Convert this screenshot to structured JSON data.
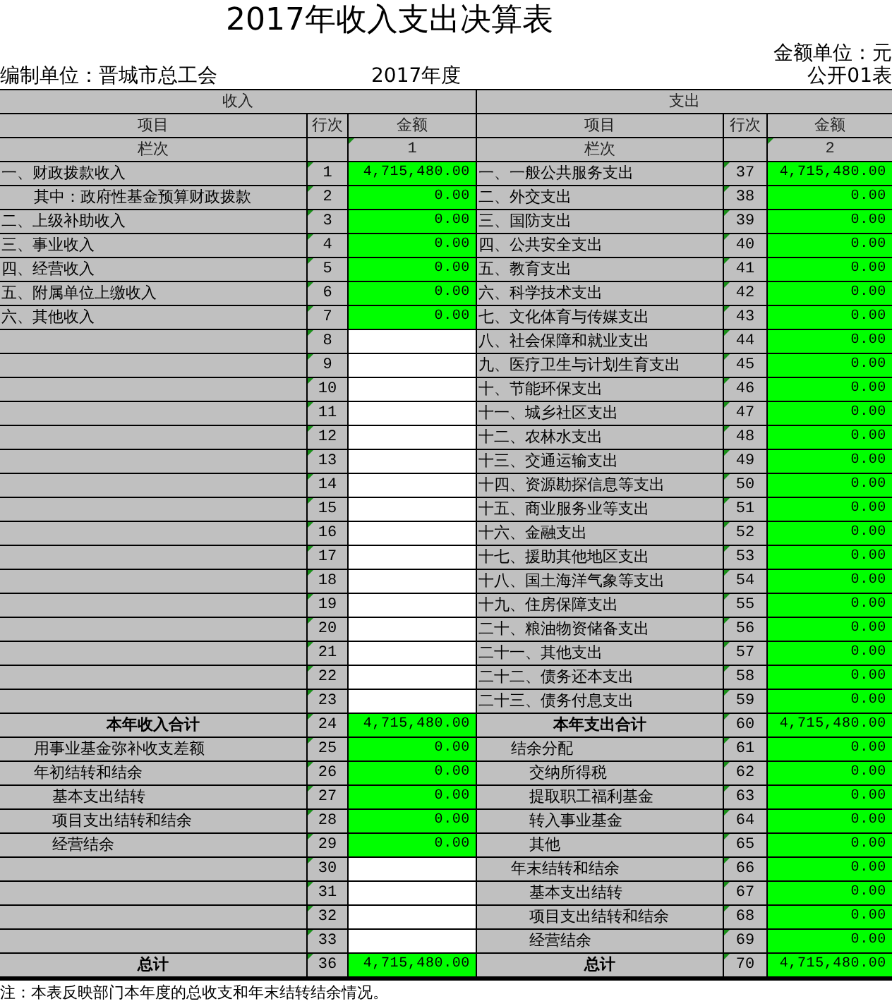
{
  "title": "2017年收入支出决算表",
  "unit_label": "金额单位：元",
  "org_label": "编制单位：晋城市总工会",
  "year_label": "2017年度",
  "form_label": "公开01表",
  "sections": [
    "收入",
    "支出"
  ],
  "columns": [
    "项目",
    "行次",
    "金额",
    "项目",
    "行次",
    "金额"
  ],
  "index_row": {
    "left_label": "栏次",
    "left_number": "1",
    "right_label": "栏次",
    "right_number": "2"
  },
  "rows": [
    {
      "left": {
        "kind": "item",
        "item": "一、财政拨款收入",
        "line": "1",
        "amount": "4,715,480.00",
        "highlighted": true
      },
      "right": {
        "kind": "item",
        "item": "一、一般公共服务支出",
        "line": "37",
        "amount": "4,715,480.00",
        "highlighted": true
      }
    },
    {
      "left": {
        "kind": "sub",
        "item": "其中：政府性基金预算财政拨款",
        "line": "2",
        "amount": "0.00",
        "highlighted": true
      },
      "right": {
        "kind": "item",
        "item": "二、外交支出",
        "line": "38",
        "amount": "0.00",
        "highlighted": true
      }
    },
    {
      "left": {
        "kind": "item",
        "item": "二、上级补助收入",
        "line": "3",
        "amount": "0.00",
        "highlighted": true
      },
      "right": {
        "kind": "item",
        "item": "三、国防支出",
        "line": "39",
        "amount": "0.00",
        "highlighted": true
      }
    },
    {
      "left": {
        "kind": "item",
        "item": "三、事业收入",
        "line": "4",
        "amount": "0.00",
        "highlighted": true
      },
      "right": {
        "kind": "item",
        "item": "四、公共安全支出",
        "line": "40",
        "amount": "0.00",
        "highlighted": true
      }
    },
    {
      "left": {
        "kind": "item",
        "item": "四、经营收入",
        "line": "5",
        "amount": "0.00",
        "highlighted": true
      },
      "right": {
        "kind": "item",
        "item": "五、教育支出",
        "line": "41",
        "amount": "0.00",
        "highlighted": true
      }
    },
    {
      "left": {
        "kind": "item",
        "item": "五、附属单位上缴收入",
        "line": "6",
        "amount": "0.00",
        "highlighted": true
      },
      "right": {
        "kind": "item",
        "item": "六、科学技术支出",
        "line": "42",
        "amount": "0.00",
        "highlighted": true
      }
    },
    {
      "left": {
        "kind": "item",
        "item": "六、其他收入",
        "line": "7",
        "amount": "0.00",
        "highlighted": true
      },
      "right": {
        "kind": "item",
        "item": "七、文化体育与传媒支出",
        "line": "43",
        "amount": "0.00",
        "highlighted": true
      }
    },
    {
      "left": {
        "kind": "blank",
        "line": "8",
        "highlighted": false
      },
      "right": {
        "kind": "item",
        "item": "八、社会保障和就业支出",
        "line": "44",
        "amount": "0.00",
        "highlighted": true
      }
    },
    {
      "left": {
        "kind": "blank",
        "line": "9",
        "highlighted": false
      },
      "right": {
        "kind": "item",
        "item": "九、医疗卫生与计划生育支出",
        "line": "45",
        "amount": "0.00",
        "highlighted": true
      }
    },
    {
      "left": {
        "kind": "blank",
        "line": "10",
        "highlighted": false
      },
      "right": {
        "kind": "item",
        "item": "十、节能环保支出",
        "line": "46",
        "amount": "0.00",
        "highlighted": true
      }
    },
    {
      "left": {
        "kind": "blank",
        "line": "11",
        "highlighted": false
      },
      "right": {
        "kind": "item",
        "item": "十一、城乡社区支出",
        "line": "47",
        "amount": "0.00",
        "highlighted": true
      }
    },
    {
      "left": {
        "kind": "blank",
        "line": "12",
        "highlighted": false
      },
      "right": {
        "kind": "item",
        "item": "十二、农林水支出",
        "line": "48",
        "amount": "0.00",
        "highlighted": true
      }
    },
    {
      "left": {
        "kind": "blank",
        "line": "13",
        "highlighted": false
      },
      "right": {
        "kind": "item",
        "item": "十三、交通运输支出",
        "line": "49",
        "amount": "0.00",
        "highlighted": true
      }
    },
    {
      "left": {
        "kind": "blank",
        "line": "14",
        "highlighted": false
      },
      "right": {
        "kind": "item",
        "item": "十四、资源勘探信息等支出",
        "line": "50",
        "amount": "0.00",
        "highlighted": true
      }
    },
    {
      "left": {
        "kind": "blank",
        "line": "15",
        "highlighted": false
      },
      "right": {
        "kind": "item",
        "item": "十五、商业服务业等支出",
        "line": "51",
        "amount": "0.00",
        "highlighted": true
      }
    },
    {
      "left": {
        "kind": "blank",
        "line": "16",
        "highlighted": false
      },
      "right": {
        "kind": "item",
        "item": "十六、金融支出",
        "line": "52",
        "amount": "0.00",
        "highlighted": true
      }
    },
    {
      "left": {
        "kind": "blank",
        "line": "17",
        "highlighted": false
      },
      "right": {
        "kind": "item",
        "item": "十七、援助其他地区支出",
        "line": "53",
        "amount": "0.00",
        "highlighted": true
      }
    },
    {
      "left": {
        "kind": "blank",
        "line": "18",
        "highlighted": false
      },
      "right": {
        "kind": "item",
        "item": "十八、国土海洋气象等支出",
        "line": "54",
        "amount": "0.00",
        "highlighted": true
      }
    },
    {
      "left": {
        "kind": "blank",
        "line": "19",
        "highlighted": false
      },
      "right": {
        "kind": "item",
        "item": "十九、住房保障支出",
        "line": "55",
        "amount": "0.00",
        "highlighted": true
      }
    },
    {
      "left": {
        "kind": "blank",
        "line": "20",
        "highlighted": false
      },
      "right": {
        "kind": "item",
        "item": "二十、粮油物资储备支出",
        "line": "56",
        "amount": "0.00",
        "highlighted": true
      }
    },
    {
      "left": {
        "kind": "blank",
        "line": "21",
        "highlighted": false
      },
      "right": {
        "kind": "item",
        "item": "二十一、其他支出",
        "line": "57",
        "amount": "0.00",
        "highlighted": true
      }
    },
    {
      "left": {
        "kind": "blank",
        "line": "22",
        "highlighted": false
      },
      "right": {
        "kind": "item",
        "item": "二十二、债务还本支出",
        "line": "58",
        "amount": "0.00",
        "highlighted": true
      }
    },
    {
      "left": {
        "kind": "blank",
        "line": "23",
        "highlighted": false
      },
      "right": {
        "kind": "item",
        "item": "二十三、债务付息支出",
        "line": "59",
        "amount": "0.00",
        "highlighted": true
      }
    },
    {
      "left": {
        "kind": "total",
        "item": "本年收入合计",
        "line": "24",
        "amount": "4,715,480.00",
        "highlighted": true
      },
      "right": {
        "kind": "total",
        "item": "本年支出合计",
        "line": "60",
        "amount": "4,715,480.00",
        "highlighted": true
      }
    },
    {
      "left": {
        "kind": "sub",
        "item": "用事业基金弥补收支差额",
        "line": "25",
        "amount": "0.00",
        "highlighted": true
      },
      "right": {
        "kind": "sub",
        "item": "结余分配",
        "line": "61",
        "amount": "0.00",
        "highlighted": true
      }
    },
    {
      "left": {
        "kind": "sub",
        "item": "年初结转和结余",
        "line": "26",
        "amount": "0.00",
        "highlighted": true
      },
      "right": {
        "kind": "subsub",
        "item": "交纳所得税",
        "line": "62",
        "amount": "0.00",
        "highlighted": true
      }
    },
    {
      "left": {
        "kind": "subsub",
        "item": "基本支出结转",
        "line": "27",
        "amount": "0.00",
        "highlighted": true
      },
      "right": {
        "kind": "subsub",
        "item": "提取职工福利基金",
        "line": "63",
        "amount": "0.00",
        "highlighted": true
      }
    },
    {
      "left": {
        "kind": "subsub",
        "item": "项目支出结转和结余",
        "line": "28",
        "amount": "0.00",
        "highlighted": true
      },
      "right": {
        "kind": "subsub",
        "item": "转入事业基金",
        "line": "64",
        "amount": "0.00",
        "highlighted": true
      }
    },
    {
      "left": {
        "kind": "subsub",
        "item": "经营结余",
        "line": "29",
        "amount": "0.00",
        "highlighted": true
      },
      "right": {
        "kind": "subsub",
        "item": "其他",
        "line": "65",
        "amount": "0.00",
        "highlighted": true
      }
    },
    {
      "left": {
        "kind": "blank",
        "line": "30",
        "highlighted": false
      },
      "right": {
        "kind": "sub",
        "item": "年末结转和结余",
        "line": "66",
        "amount": "0.00",
        "highlighted": true
      }
    },
    {
      "left": {
        "kind": "blank",
        "line": "31",
        "highlighted": false
      },
      "right": {
        "kind": "subsub",
        "item": "基本支出结转",
        "line": "67",
        "amount": "0.00",
        "highlighted": true
      }
    },
    {
      "left": {
        "kind": "blank",
        "line": "32",
        "highlighted": false
      },
      "right": {
        "kind": "subsub",
        "item": "项目支出结转和结余",
        "line": "68",
        "amount": "0.00",
        "highlighted": true
      }
    },
    {
      "left": {
        "kind": "blank",
        "line": "33",
        "highlighted": false
      },
      "right": {
        "kind": "subsub",
        "item": "经营结余",
        "line": "69",
        "amount": "0.00",
        "highlighted": true
      }
    },
    {
      "left": {
        "kind": "total",
        "item": "总计",
        "line": "36",
        "amount": "4,715,480.00",
        "highlighted": true
      },
      "right": {
        "kind": "total",
        "item": "总计",
        "line": "70",
        "amount": "4,715,480.00",
        "highlighted": true
      }
    }
  ],
  "note": "注：本表反映部门本年度的总收支和年末结转结余情况。"
}
